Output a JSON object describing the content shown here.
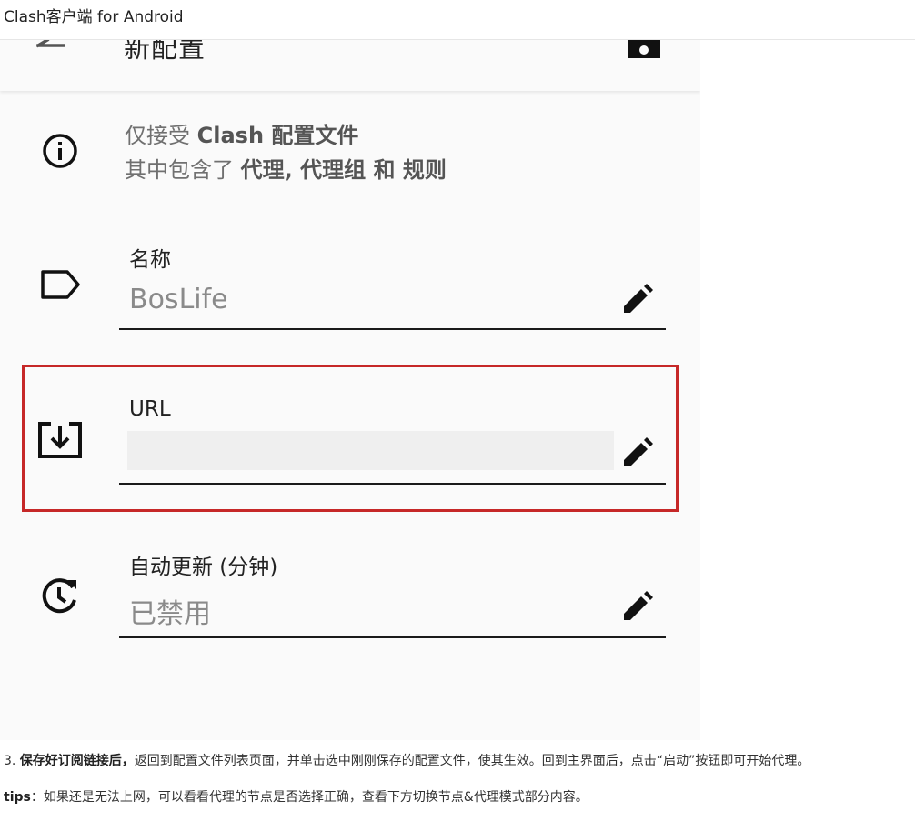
{
  "page": {
    "title": "Clash客户端 for Android"
  },
  "screenshot": {
    "appbar": {
      "title": "新配置"
    },
    "info": {
      "line1_prefix": "仅接受 ",
      "line1_bold": "Clash 配置文件",
      "line2_prefix": "其中包含了 ",
      "line2_bold": "代理, 代理组 和 规则"
    },
    "fields": {
      "name": {
        "label": "名称",
        "value": "BosLife"
      },
      "url": {
        "label": "URL",
        "value": ""
      },
      "auto_update": {
        "label": "自动更新 (分钟)",
        "value": "已禁用"
      }
    },
    "highlight_color": "#c62828"
  },
  "instructions": {
    "step3_prefix": "3. ",
    "step3_bold": "保存好订阅链接后，",
    "step3_text": "返回到配置文件列表页面，并单击选中刚刚保存的配置文件，使其生效。回到主界面后，点击“启动”按钮即可开始代理。",
    "tips_label": "tips",
    "tips_text": "：如果还是无法上网，可以看看代理的节点是否选择正确，查看下方切换节点&代理模式部分内容。"
  }
}
